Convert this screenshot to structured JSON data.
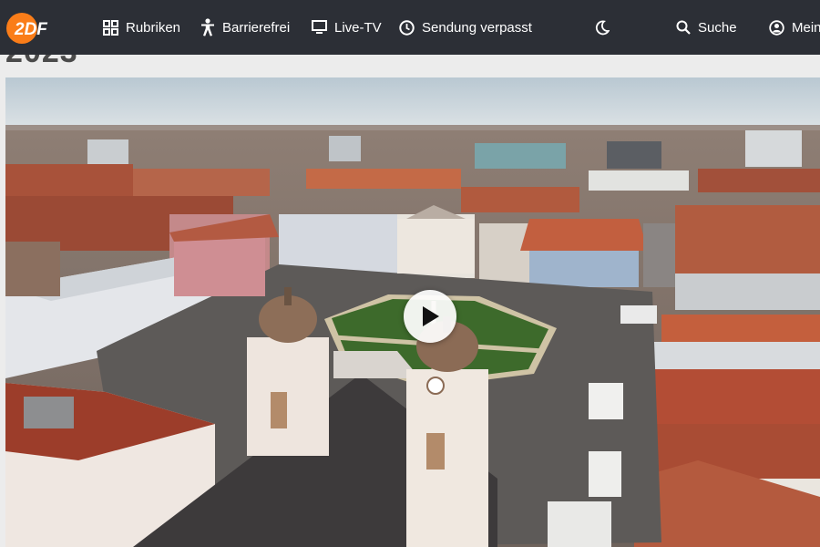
{
  "header": {
    "logo_text": "2DF",
    "nav": [
      {
        "label": "Rubriken",
        "icon": "grid-icon"
      },
      {
        "label": "Barrierefrei",
        "icon": "accessibility-icon"
      },
      {
        "label": "Live-TV",
        "icon": "tv-icon"
      },
      {
        "label": "Sendung verpasst",
        "icon": "clock-icon"
      }
    ],
    "theme_toggle_icon": "moon-icon",
    "search_label": "Suche",
    "account_label": "Mein"
  },
  "page": {
    "title_clipped": "2023"
  },
  "player": {
    "play_icon": "play-icon"
  },
  "colors": {
    "header_bg": "#2c2f36",
    "logo_orange": "#fa7d19",
    "page_bg": "#ececec"
  }
}
